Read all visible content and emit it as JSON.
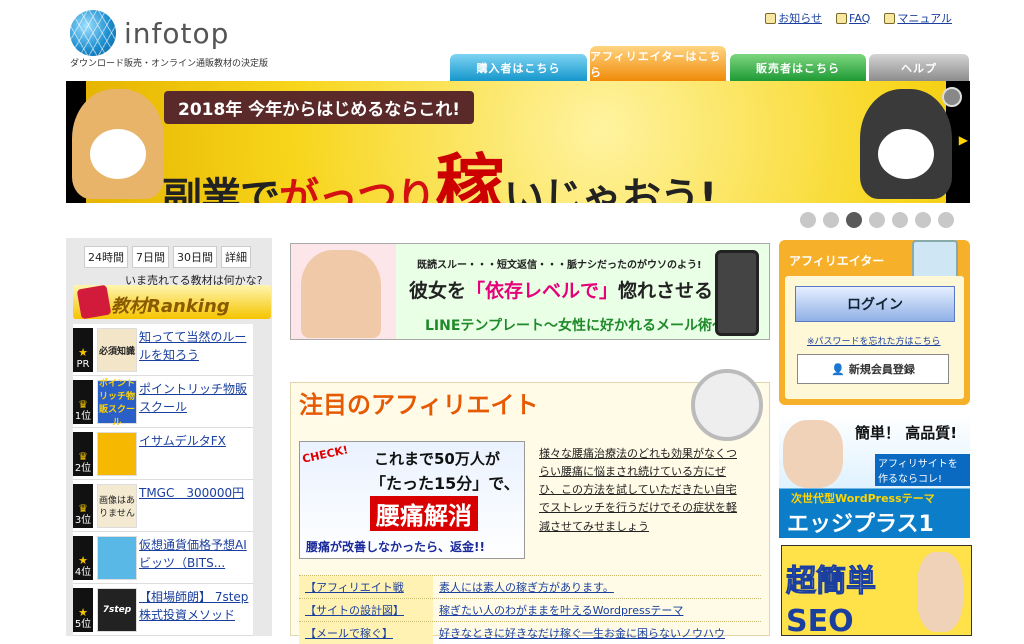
{
  "header": {
    "logo_text": "infotop",
    "tagline": "ダウンロード販売・オンライン通販教材の決定版",
    "links": [
      {
        "label": "お知らせ",
        "icon": "lamp-icon"
      },
      {
        "label": "FAQ",
        "icon": "book-icon"
      },
      {
        "label": "マニュアル",
        "icon": "clipboard-icon"
      }
    ],
    "tabs": [
      "購入者はこちら",
      "アフィリエイターはこちら",
      "販売者はこちら",
      "ヘルプ"
    ]
  },
  "banner": {
    "top": "2018年 今年からはじめるならこれ!",
    "main_a": "副業で",
    "main_b": "がっつり",
    "main_c": "稼",
    "main_d": "いじゃおう!"
  },
  "carousel": {
    "count": 7,
    "active": 3
  },
  "ranking": {
    "periods": [
      "24時間",
      "7日間",
      "30日間",
      "詳細"
    ],
    "question": "いま売れてる教材は何かな?",
    "title": "教材Ranking",
    "items": [
      {
        "rank": "PR",
        "thumb": "必須知識",
        "label": "知ってて当然のルールを知ろう"
      },
      {
        "rank": "1位",
        "thumb": "ポイントリッチ物販スクール",
        "label": "ポイントリッチ物販スクール"
      },
      {
        "rank": "2位",
        "thumb": "",
        "label": "イサムデルタFX"
      },
      {
        "rank": "3位",
        "thumb": "画像はありません",
        "label": "TMGC　300000円"
      },
      {
        "rank": "4位",
        "thumb": "",
        "label": "仮想通貨価格予想AIビッツ（BITS..."
      },
      {
        "rank": "5位",
        "thumb": "7step",
        "label": "【相場師朗】 7step株式投資メソッド"
      }
    ]
  },
  "center_banner": {
    "top": "既読スルー・・・短文返信・・・脈ナシだったのがウソのよう!",
    "mid_a": "彼女を",
    "mid_b": "「依存レベルで」",
    "mid_c": "惚れさせる!",
    "bottom": "LINEテンプレート～女性に好かれるメール術～"
  },
  "feature": {
    "title": "注目のアフィリエイト",
    "ad": {
      "check": "CHECK!",
      "l1": "これまで50万人が",
      "l2": "「たった15分」で、",
      "l3": "腰痛解消",
      "l4": "腰痛が改善しなかったら、返金!!"
    },
    "desc": "様々な腰痛治療法のどれも効果がなくつらい腰痛に悩まされ続けている方にぜひ、この方法を試していただきたい自宅でストレッチを行うだけでその症状を軽減させてみせましょう",
    "links": [
      {
        "k": "【アフィリエイト戦",
        "v": "素人には素人の稼ぎ方があります。"
      },
      {
        "k": "【サイトの設計図】",
        "v": "稼ぎたい人のわがままを叶えるWordpressテーマ"
      },
      {
        "k": "【メールで稼ぐ】",
        "v": "好きなときに好きなだけ稼ぐ一生お金に困らないノウハウ"
      }
    ]
  },
  "affiliate_box": {
    "title": "アフィリエイター",
    "login": "ログイン",
    "forgot": "※パスワードを忘れた方はこちら",
    "register": "新規会員登録"
  },
  "ad1": {
    "a": "簡単！ 高品質!",
    "b": "アフィリサイトを作るならコレ!",
    "c": "次世代型WordPressテーマ",
    "d": "エッジプラス1"
  },
  "ad2": {
    "a": "超簡単",
    "b": "SEO"
  }
}
